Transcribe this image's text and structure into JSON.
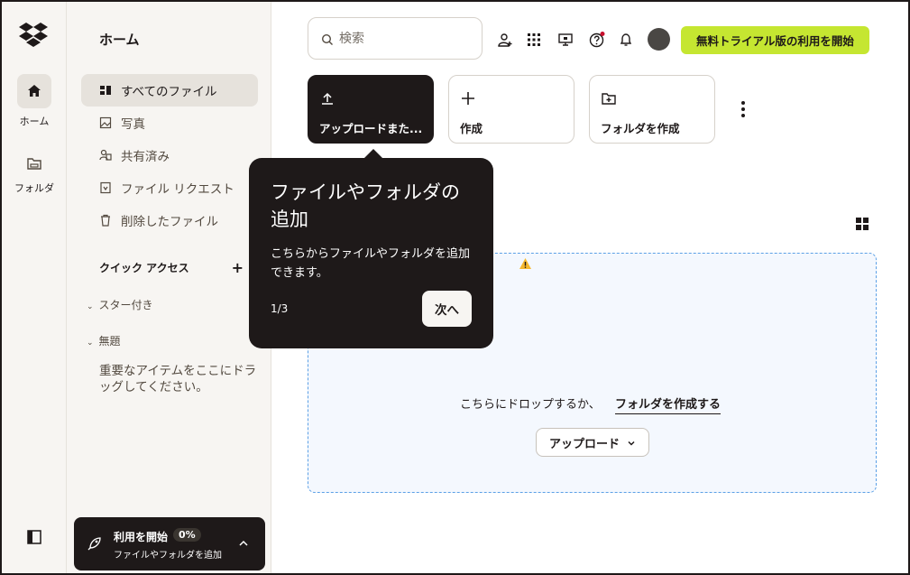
{
  "colors": {
    "brand": "#1e1919",
    "accent": "#c5e631",
    "dropzone_border": "#5ba0e6",
    "notification_dot": "#c8102e"
  },
  "rail": {
    "logo": "dropbox-logo",
    "items": [
      {
        "label": "ホーム",
        "icon": "home-icon"
      },
      {
        "label": "フォルダ",
        "icon": "folder-icon"
      }
    ],
    "collapse_icon": "sidebar-toggle-icon"
  },
  "sidebar": {
    "title": "ホーム",
    "nav": [
      {
        "label": "すべてのファイル",
        "icon": "all-files-icon",
        "active": true
      },
      {
        "label": "写真",
        "icon": "photo-icon"
      },
      {
        "label": "共有済み",
        "icon": "shared-icon"
      },
      {
        "label": "ファイル リクエスト",
        "icon": "file-request-icon"
      },
      {
        "label": "削除したファイル",
        "icon": "trash-icon"
      }
    ],
    "quick_access": {
      "title": "クイック アクセス",
      "add_label": "+"
    },
    "sections": [
      {
        "label": "スター付き"
      },
      {
        "label": "無題"
      }
    ],
    "drop_hint": "重要なアイテムをここにドラッグしてください。",
    "start_card": {
      "title": "利用を開始",
      "progress": "0%",
      "subtitle": "ファイルやフォルダを追加"
    }
  },
  "topbar": {
    "search_placeholder": "検索",
    "icons": [
      "add-member-icon",
      "apps-grid-icon",
      "screen-icon",
      "help-icon",
      "bell-icon"
    ],
    "trial_button": "無料トライアル版の利用を開始"
  },
  "actions": [
    {
      "label": "アップロードまた...",
      "icon": "upload-icon"
    },
    {
      "label": "作成",
      "icon": "plus-icon"
    },
    {
      "label": "フォルダを作成",
      "icon": "new-folder-icon"
    }
  ],
  "dropzone": {
    "text": "こちらにドロップするか、",
    "link": "フォルダを作成する",
    "upload_button": "アップロード"
  },
  "tooltip": {
    "title": "ファイルやフォルダの追加",
    "body": "こちらからファイルやフォルダを追加できます。",
    "step": "1/3",
    "next_button": "次へ"
  }
}
